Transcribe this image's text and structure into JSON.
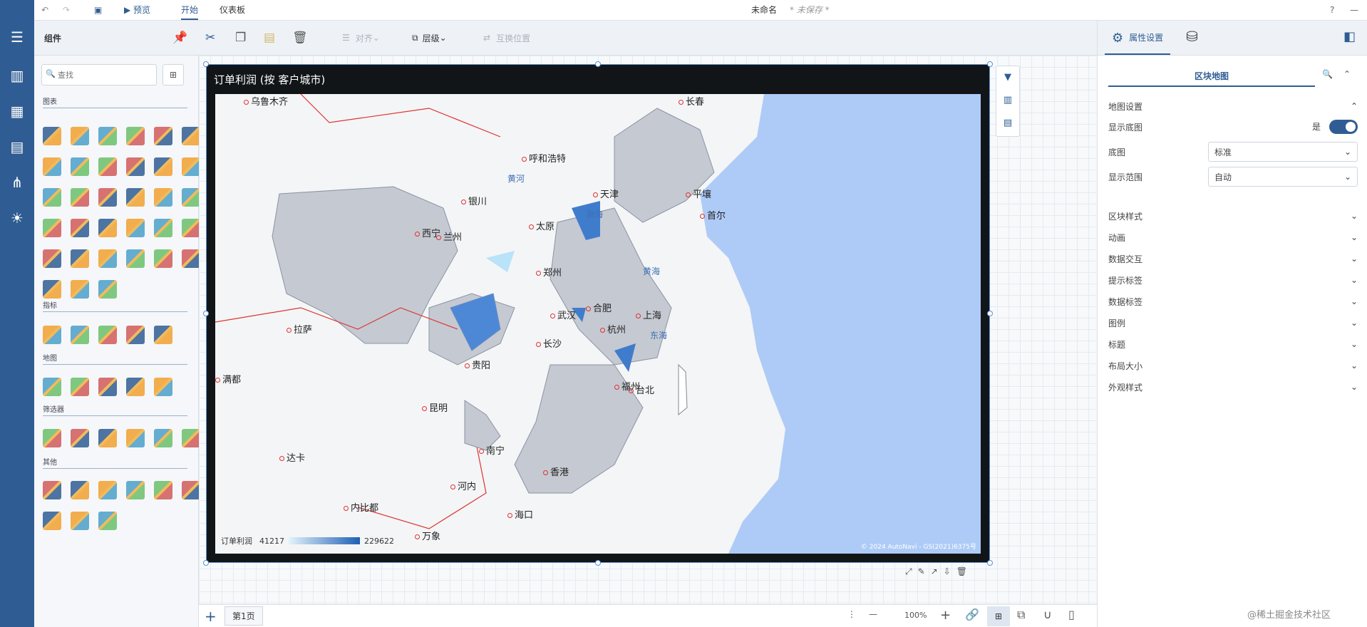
{
  "top": {
    "undo": "↶",
    "redo": "↷",
    "preview": "预览",
    "tab_start": "开始",
    "tab_dashboard": "仪表板",
    "doc_name": "未命名",
    "unsaved": "* 未保存 *",
    "help": "?",
    "min": "—"
  },
  "toolbar": {
    "section": "组件",
    "align": "对齐",
    "layer": "层级",
    "swap": "互换位置"
  },
  "leftpanel": {
    "search_placeholder": "查找",
    "sec_charts": "图表",
    "sec_indicators": "指标",
    "sec_maps": "地图",
    "sec_filters": "筛选器",
    "sec_others": "其他"
  },
  "widget": {
    "title": "订单利润 (按 客户城市)",
    "legend_label": "订单利润",
    "legend_min": "41217",
    "legend_max": "229622",
    "credit": "© 2024 AutoNavi - GS(2021)6375号"
  },
  "map": {
    "cities": [
      "乌鲁木齐",
      "长春",
      "呼和浩特",
      "银川",
      "太原",
      "天津",
      "平壤",
      "首尔",
      "西宁",
      "兰州",
      "郑州",
      "合肥",
      "上海",
      "武汉",
      "拉萨",
      "长沙",
      "杭州",
      "福州",
      "贵阳",
      "台北",
      "昆明",
      "南宁",
      "香港",
      "河内",
      "海口",
      "达卡",
      "内比都",
      "万象",
      "满都"
    ],
    "seas": [
      "黄河",
      "渤海",
      "黄海",
      "东海"
    ]
  },
  "right": {
    "tab_props": "属性设置",
    "sub_title": "区块地图",
    "map_settings": "地图设置",
    "show_base": "显示底图",
    "show_base_val": "是",
    "base_map": "底图",
    "base_map_val": "标准",
    "range": "显示范围",
    "range_val": "自动",
    "sections": [
      "区块样式",
      "动画",
      "数据交互",
      "提示标签",
      "数据标签",
      "图例",
      "标题",
      "布局大小",
      "外观样式"
    ]
  },
  "bottom": {
    "page": "第1页",
    "zoom": "100%",
    "watermark": "@稀土掘金技术社区"
  }
}
